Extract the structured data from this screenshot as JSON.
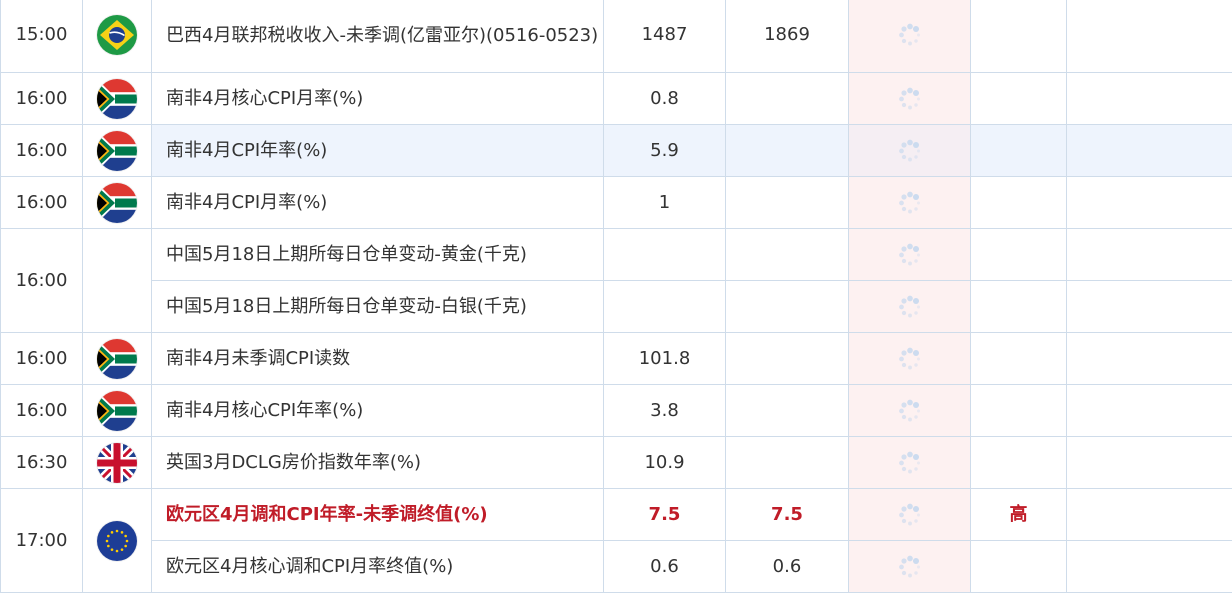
{
  "colors": {
    "highlight_red": "#c01c28",
    "border": "#cfdcea",
    "importance_bg": "#fdf1f1",
    "row_hover": "#eef4fd"
  },
  "rows": [
    {
      "time": "15:00",
      "flag": "brazil-flag-icon",
      "event": "巴西4月联邦税收收入-未季调(亿雷亚尔)(0516-0523)",
      "previous": "1487",
      "forecast": "1869",
      "actual": "",
      "level": ""
    },
    {
      "time": "16:00",
      "flag": "south-africa-flag-icon",
      "event": "南非4月核心CPI月率(%)",
      "previous": "0.8",
      "forecast": "",
      "actual": "",
      "level": ""
    },
    {
      "time": "16:00",
      "flag": "south-africa-flag-icon",
      "event": "南非4月CPI年率(%)",
      "previous": "5.9",
      "forecast": "",
      "actual": "",
      "level": ""
    },
    {
      "time": "16:00",
      "flag": "south-africa-flag-icon",
      "event": "南非4月CPI月率(%)",
      "previous": "1",
      "forecast": "",
      "actual": "",
      "level": ""
    },
    {
      "time": "16:00",
      "flag": "",
      "event": "中国5月18日上期所每日仓单变动-黄金(千克)",
      "previous": "",
      "forecast": "",
      "actual": "",
      "level": ""
    },
    {
      "time": "",
      "flag": "",
      "event": "中国5月18日上期所每日仓单变动-白银(千克)",
      "previous": "",
      "forecast": "",
      "actual": "",
      "level": ""
    },
    {
      "time": "16:00",
      "flag": "south-africa-flag-icon",
      "event": "南非4月未季调CPI读数",
      "previous": "101.8",
      "forecast": "",
      "actual": "",
      "level": ""
    },
    {
      "time": "16:00",
      "flag": "south-africa-flag-icon",
      "event": "南非4月核心CPI年率(%)",
      "previous": "3.8",
      "forecast": "",
      "actual": "",
      "level": ""
    },
    {
      "time": "16:30",
      "flag": "uk-flag-icon",
      "event": "英国3月DCLG房价指数年率(%)",
      "previous": "10.9",
      "forecast": "",
      "actual": "",
      "level": ""
    },
    {
      "time": "17:00",
      "flag": "eu-flag-icon",
      "event": "欧元区4月调和CPI年率-未季调终值(%)",
      "previous": "7.5",
      "forecast": "7.5",
      "actual": "",
      "level": "高"
    },
    {
      "time": "",
      "flag": "",
      "event": "欧元区4月核心调和CPI月率终值(%)",
      "previous": "0.6",
      "forecast": "0.6",
      "actual": "",
      "level": ""
    }
  ]
}
